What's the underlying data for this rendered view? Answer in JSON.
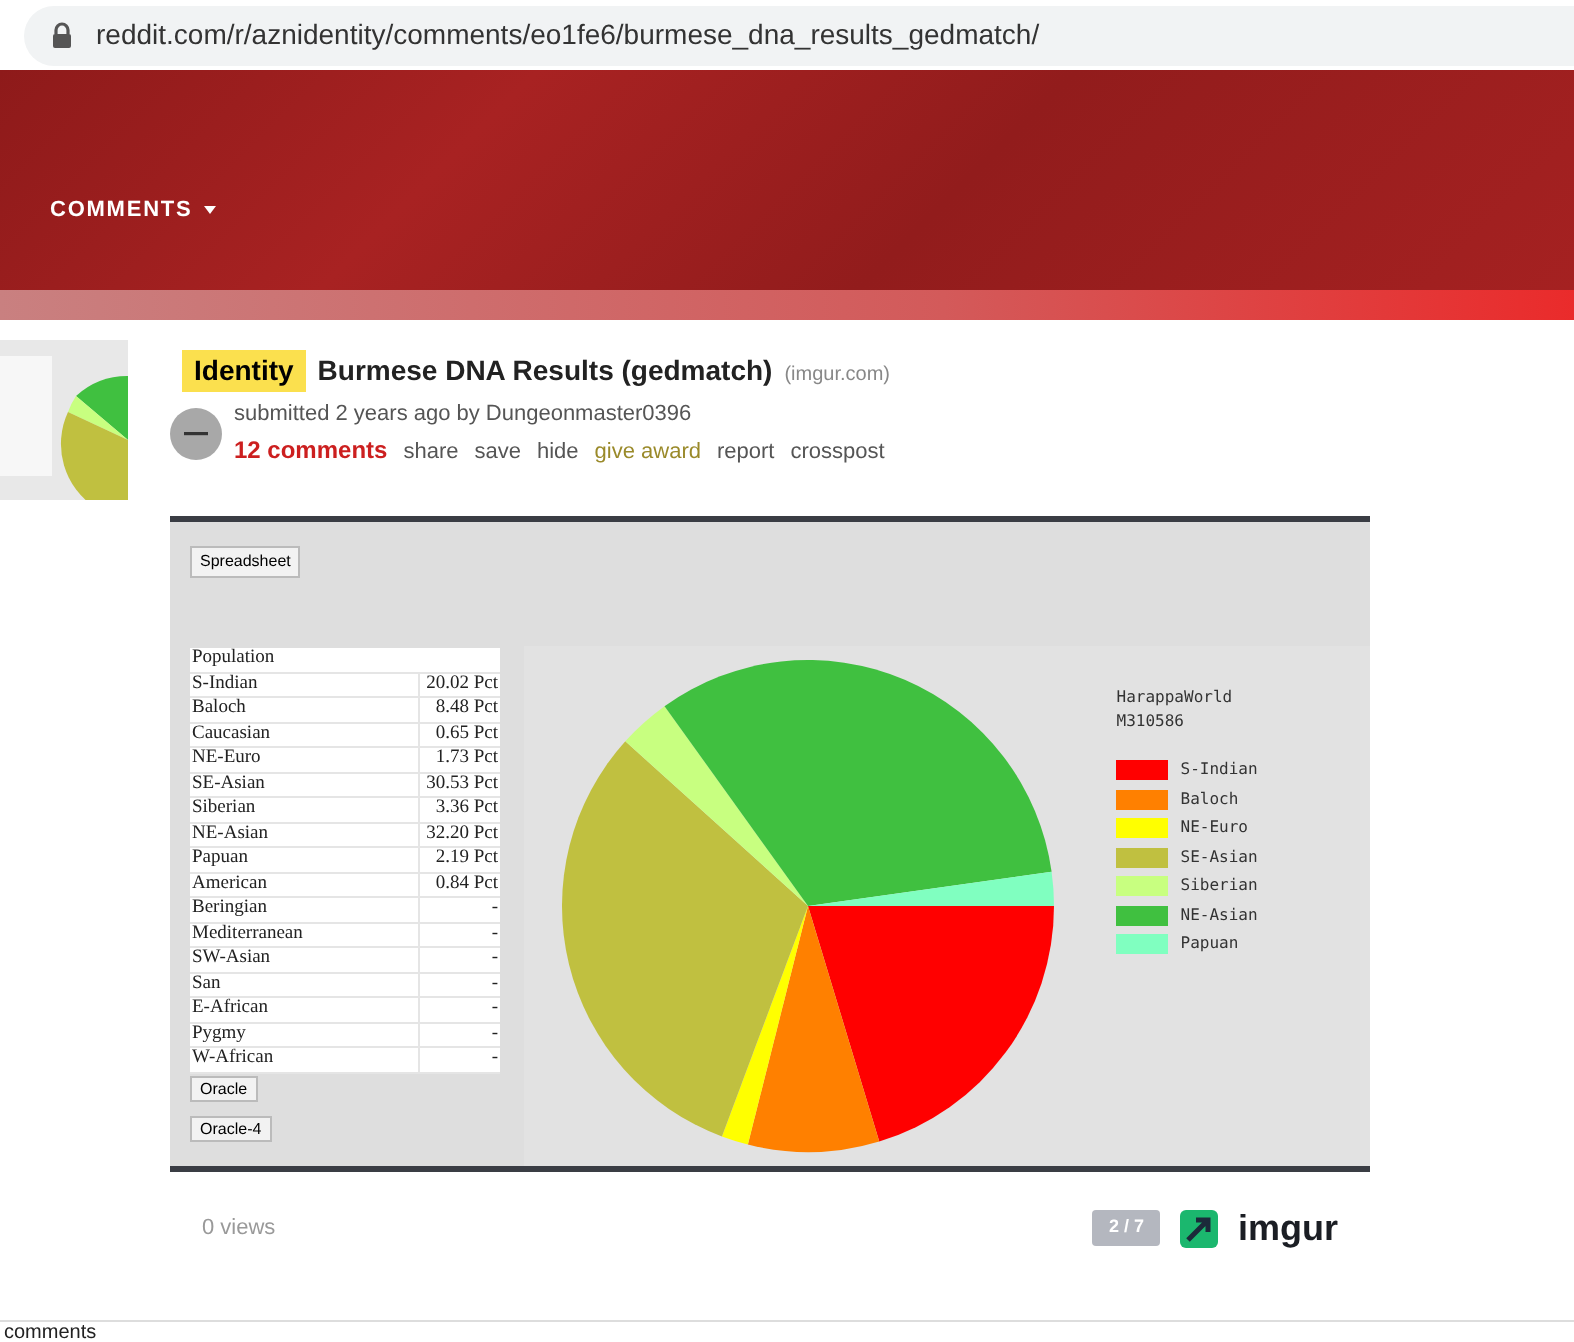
{
  "address_bar": {
    "url": "reddit.com/r/aznidentity/comments/eo1fe6/burmese_dna_results_gedmatch/"
  },
  "header": {
    "menu": "COMMENTS"
  },
  "post": {
    "flair": "Identity",
    "title": "Burmese DNA Results (gedmatch)",
    "domain": "(imgur.com)",
    "submitted": "submitted 2 years ago by",
    "author": "Dungeonmaster0396",
    "actions": [
      {
        "label": "12 comments",
        "kind": "comments"
      },
      {
        "label": "share",
        "kind": "link"
      },
      {
        "label": "save",
        "kind": "link"
      },
      {
        "label": "hide",
        "kind": "link"
      },
      {
        "label": "give award",
        "kind": "award"
      },
      {
        "label": "report",
        "kind": "link"
      },
      {
        "label": "crosspost",
        "kind": "link"
      }
    ]
  },
  "embed": {
    "top_button": "Spreadsheet",
    "table": {
      "header": "Population",
      "rows": [
        {
          "population": "S-Indian",
          "value": "20.02 Pct"
        },
        {
          "population": "Baloch",
          "value": "8.48 Pct"
        },
        {
          "population": "Caucasian",
          "value": "0.65 Pct"
        },
        {
          "population": "NE-Euro",
          "value": "1.73 Pct"
        },
        {
          "population": "SE-Asian",
          "value": "30.53 Pct"
        },
        {
          "population": "Siberian",
          "value": "3.36 Pct"
        },
        {
          "population": "NE-Asian",
          "value": "32.20 Pct"
        },
        {
          "population": "Papuan",
          "value": "2.19 Pct"
        },
        {
          "population": "American",
          "value": "0.84 Pct"
        },
        {
          "population": "Beringian",
          "value": "-"
        },
        {
          "population": "Mediterranean",
          "value": "-"
        },
        {
          "population": "SW-Asian",
          "value": "-"
        },
        {
          "population": "San",
          "value": "-"
        },
        {
          "population": "E-African",
          "value": "-"
        },
        {
          "population": "Pygmy",
          "value": "-"
        },
        {
          "population": "W-African",
          "value": "-"
        }
      ]
    },
    "bottom_buttons": [
      "Oracle",
      "Oracle-4"
    ],
    "chart_data": {
      "type": "pie",
      "title": "HarappaWorld",
      "annotations": [
        "M310586"
      ],
      "categories": [
        "S-Indian",
        "Baloch",
        "NE-Euro",
        "SE-Asian",
        "Siberian",
        "NE-Asian",
        "Papuan"
      ],
      "series": [
        {
          "colors": [
            "#ff0000",
            "#ff8000",
            "#ffff00",
            "#c0c040",
            "#c8ff80",
            "#40c040",
            "#80ffc0"
          ],
          "values": [
            20.02,
            8.48,
            1.73,
            30.53,
            3.36,
            32.2,
            2.19
          ]
        }
      ]
    }
  },
  "footer": {
    "views": "0 views",
    "pager": "2 / 7",
    "logo": "imgur"
  },
  "section": {
    "heading": "comments"
  }
}
